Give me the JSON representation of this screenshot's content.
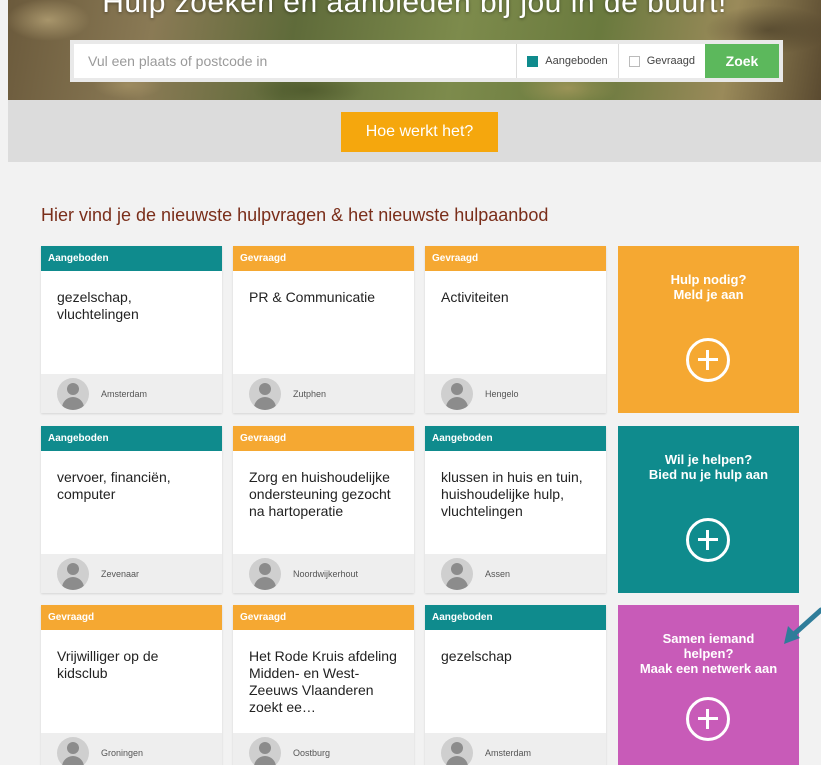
{
  "hero": {
    "title": "Hulp zoeken en aanbieden bij jou in de buurt!",
    "search_placeholder": "Vul een plaats of postcode in",
    "filter_offered": "Aangeboden",
    "filter_requested": "Gevraagd",
    "search_button": "Zoek"
  },
  "how_button": "Hoe werkt het?",
  "section_title": "Hier vind je de nieuwste hulpvragen & het nieuwste hulpaanbod",
  "cards": [
    {
      "tag": "Aangeboden",
      "title": "gezelschap, vluchtelingen",
      "place": "Amsterdam"
    },
    {
      "tag": "Gevraagd",
      "title": "PR & Communicatie",
      "place": "Zutphen"
    },
    {
      "tag": "Gevraagd",
      "title": "Activiteiten",
      "place": "Hengelo"
    },
    {
      "tag": "Aangeboden",
      "title": "vervoer, financiën, computer",
      "place": "Zevenaar"
    },
    {
      "tag": "Gevraagd",
      "title": "Zorg en huishoudelijke ondersteuning gezocht na hartoperatie",
      "place": "Noordwijkerhout"
    },
    {
      "tag": "Aangeboden",
      "title": "klussen in huis en tuin, huishoudelijke hulp, vluchtelingen",
      "place": "Assen"
    },
    {
      "tag": "Gevraagd",
      "title": "Vrijwilliger op de kidsclub",
      "place": "Groningen"
    },
    {
      "tag": "Gevraagd",
      "title": "Het Rode Kruis afdeling Midden- en West- Zeeuws Vlaanderen zoekt ee…",
      "place": "Oostburg"
    },
    {
      "tag": "Aangeboden",
      "title": "gezelschap",
      "place": "Amsterdam"
    }
  ],
  "cta": {
    "need_help": {
      "line1": "Hulp nodig?",
      "line2": "Meld je aan"
    },
    "want_help": {
      "line1": "Wil je helpen?",
      "line2": "Bied nu je hulp aan"
    },
    "network": {
      "line1": "Samen iemand",
      "line2": "helpen?",
      "line3": "Maak een netwerk aan"
    }
  },
  "colors": {
    "teal": "#0f8b8d",
    "orange": "#f5a832",
    "magenta": "#c85bb8",
    "green": "#5cb85c",
    "title_brown": "#7a2e1a"
  }
}
